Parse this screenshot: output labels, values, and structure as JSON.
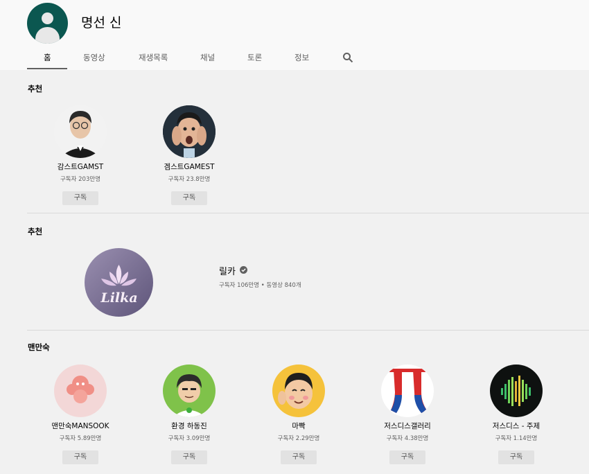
{
  "channel": {
    "name": "명선 신"
  },
  "tabs": [
    "홈",
    "동영상",
    "재생목록",
    "채널",
    "토론",
    "정보"
  ],
  "section1": {
    "title": "추천",
    "channels": [
      {
        "name": "감스트GAMST",
        "subs": "구독자 203만명",
        "button": "구독"
      },
      {
        "name": "겜스트GAMEST",
        "subs": "구독자 23.8만명",
        "button": "구독"
      }
    ]
  },
  "section2": {
    "title": "추천",
    "featured": {
      "name": "릴카",
      "stats": "구독자 106만명 • 동영상 840개",
      "logo_text": "Lilka"
    }
  },
  "section3": {
    "title": "맨만숙",
    "channels": [
      {
        "name": "맨만숙MANSOOK",
        "subs": "구독자 5.89만명",
        "button": "구독"
      },
      {
        "name": "환경 하동진",
        "subs": "구독자 3.09만명",
        "button": "구독"
      },
      {
        "name": "마빡",
        "subs": "구독자 2.29만명",
        "button": "구독"
      },
      {
        "name": "저스디스갤러리",
        "subs": "구독자 4.38만명",
        "button": "구독"
      },
      {
        "name": "저스디스 - 주제",
        "subs": "구독자 1.14만명",
        "button": "구독"
      }
    ]
  },
  "icons": {
    "search": "search-icon",
    "verified": "verified-check-icon"
  },
  "colors": {
    "avatar_bg": "#0b5750",
    "header_bg": "#f9f9f9",
    "page_bg": "#f1f1f1",
    "button_bg": "#e2e2e2"
  }
}
